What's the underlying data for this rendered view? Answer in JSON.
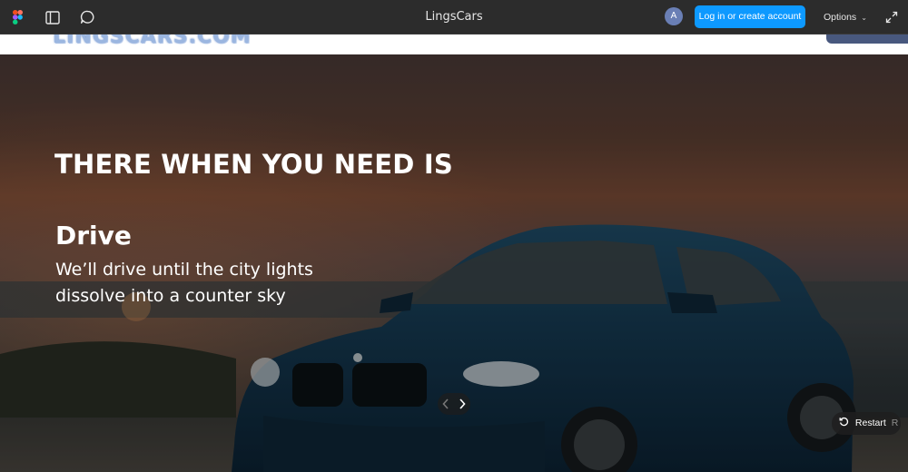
{
  "toolbar": {
    "title": "LingsCars",
    "avatar_initial": "A",
    "login_label": "Log in or create account",
    "options_label": "Options",
    "accent_color": "#0d99ff",
    "icons": [
      "figma-logo-icon",
      "sidebar-panel-icon",
      "comment-icon",
      "chevron-down-icon",
      "fullscreen-expand-icon"
    ]
  },
  "site": {
    "logo_text": "LINGSCARS.COM"
  },
  "hero": {
    "headline": "THERE WHEN YOU NEED IS",
    "subtitle": "Drive",
    "description": "We’ll drive until the city lights dissolve into a counter sky"
  },
  "controls": {
    "restart_label": "Restart",
    "restart_key": "R",
    "icons": [
      "chevron-left-icon",
      "chevron-right-icon",
      "restart-icon"
    ]
  }
}
